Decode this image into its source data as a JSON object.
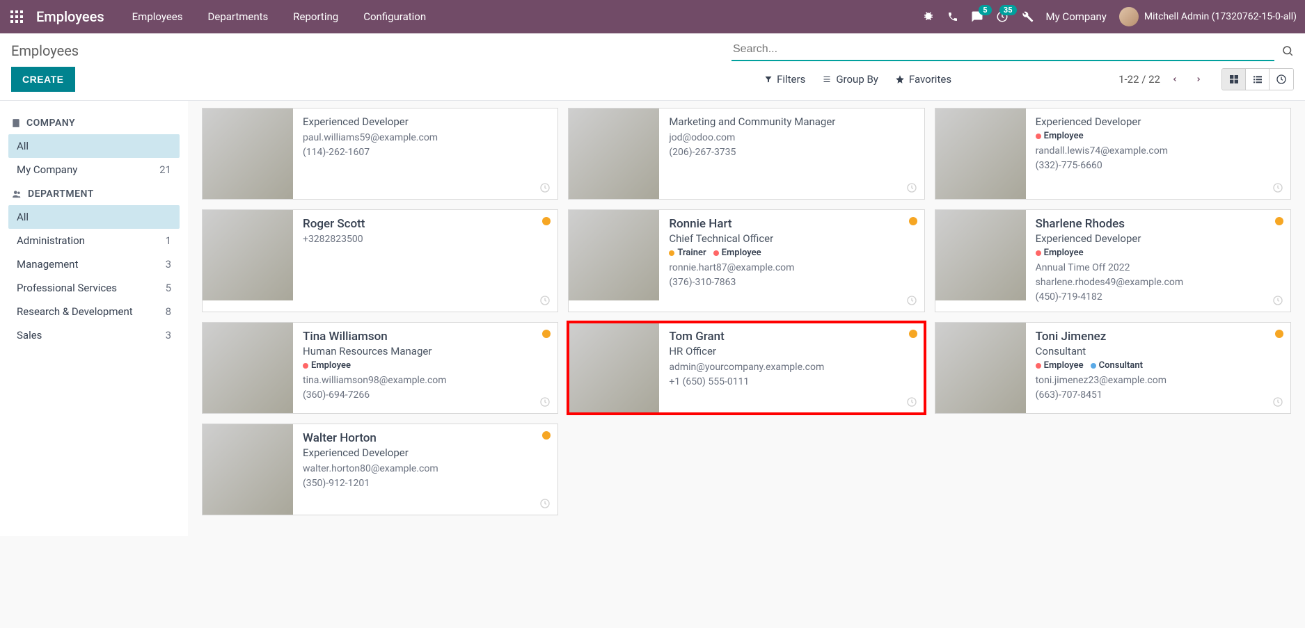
{
  "topnav": {
    "brand": "Employees",
    "menu": [
      "Employees",
      "Departments",
      "Reporting",
      "Configuration"
    ],
    "msg_badge": "5",
    "timer_badge": "35",
    "company": "My Company",
    "user_label": "Mitchell Admin (17320762-15-0-all)"
  },
  "subheader": {
    "title": "Employees",
    "search_placeholder": "Search..."
  },
  "controlbar": {
    "create": "CREATE",
    "filters": "Filters",
    "groupby": "Group By",
    "favorites": "Favorites",
    "pager": "1-22 / 22"
  },
  "sidebar": {
    "sec1_title": "COMPANY",
    "sec1_items": [
      {
        "label": "All",
        "count": "",
        "active": true
      },
      {
        "label": "My Company",
        "count": "21",
        "active": false
      }
    ],
    "sec2_title": "DEPARTMENT",
    "sec2_items": [
      {
        "label": "All",
        "count": "",
        "active": true
      },
      {
        "label": "Administration",
        "count": "1"
      },
      {
        "label": "Management",
        "count": "3"
      },
      {
        "label": "Professional Services",
        "count": "5"
      },
      {
        "label": "Research & Development",
        "count": "8"
      },
      {
        "label": "Sales",
        "count": "3"
      }
    ]
  },
  "cards": [
    {
      "name": "",
      "role": "Experienced Developer",
      "email": "paul.williams59@example.com",
      "phone": "(114)-262-1607",
      "tags": [],
      "photo": "ph1",
      "dot": false
    },
    {
      "name": "",
      "role": "Marketing and Community Manager",
      "email": "jod@odoo.com",
      "phone": "(206)-267-3735",
      "tags": [],
      "photo": "ph2",
      "dot": false
    },
    {
      "name": "",
      "role": "Experienced Developer",
      "email": "randall.lewis74@example.com",
      "phone": "(332)-775-6660",
      "tags": [
        {
          "c": "#f66",
          "t": "Employee"
        }
      ],
      "photo": "ph8",
      "dot": false
    },
    {
      "name": "Roger Scott",
      "role": "",
      "email": "",
      "phone": "+3282823500",
      "tags": [],
      "photo": "ph3",
      "dot": true
    },
    {
      "name": "Ronnie Hart",
      "role": "Chief Technical Officer",
      "email": "ronnie.hart87@example.com",
      "phone": "(376)-310-7863",
      "tags": [
        {
          "c": "#f6a623",
          "t": "Trainer"
        },
        {
          "c": "#f66",
          "t": "Employee"
        }
      ],
      "photo": "ph4",
      "dot": true
    },
    {
      "name": "Sharlene Rhodes",
      "role": "Experienced Developer",
      "email": "sharlene.rhodes49@example.com",
      "phone": "(450)-719-4182",
      "extra": "Annual Time Off 2022",
      "tags": [
        {
          "c": "#f66",
          "t": "Employee"
        }
      ],
      "photo": "ph9",
      "dot": true
    },
    {
      "name": "Tina Williamson",
      "role": "Human Resources Manager",
      "email": "tina.williamson98@example.com",
      "phone": "(360)-694-7266",
      "tags": [
        {
          "c": "#f66",
          "t": "Employee"
        }
      ],
      "photo": "ph5",
      "dot": true
    },
    {
      "name": "Tom Grant",
      "role": "HR Officer",
      "email": "admin@yourcompany.example.com",
      "phone": "+1 (650) 555-0111",
      "tags": [],
      "photo": "ph6",
      "dot": true,
      "highlighted": true
    },
    {
      "name": "Toni Jimenez",
      "role": "Consultant",
      "email": "toni.jimenez23@example.com",
      "phone": "(663)-707-8451",
      "tags": [
        {
          "c": "#f66",
          "t": "Employee"
        },
        {
          "c": "#5aa9e6",
          "t": "Consultant"
        }
      ],
      "photo": "ph10",
      "dot": true
    },
    {
      "name": "Walter Horton",
      "role": "Experienced Developer",
      "email": "walter.horton80@example.com",
      "phone": "(350)-912-1201",
      "tags": [],
      "photo": "ph7",
      "dot": true
    }
  ]
}
